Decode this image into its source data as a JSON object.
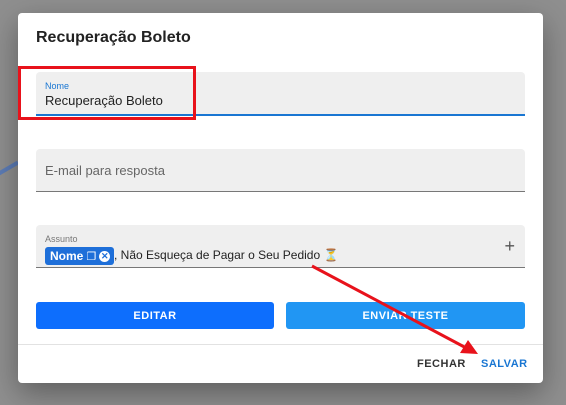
{
  "dialog": {
    "title": "Recuperação Boleto",
    "name_field": {
      "label": "Nome",
      "value": "Recuperação Boleto"
    },
    "email_field": {
      "placeholder": "E-mail para resposta"
    },
    "subject_field": {
      "label": "Assunto",
      "chip_label": "Nome",
      "text": ", Não Esqueça de Pagar o Seu Pedido ⏳"
    },
    "buttons": {
      "edit": "EDITAR",
      "send_test": "ENVIAR TESTE"
    },
    "footer": {
      "close": "FECHAR",
      "save": "SALVAR"
    }
  },
  "colors": {
    "primary": "#0d6efd",
    "secondary": "#2196f3",
    "annotation": "#e8121b"
  }
}
